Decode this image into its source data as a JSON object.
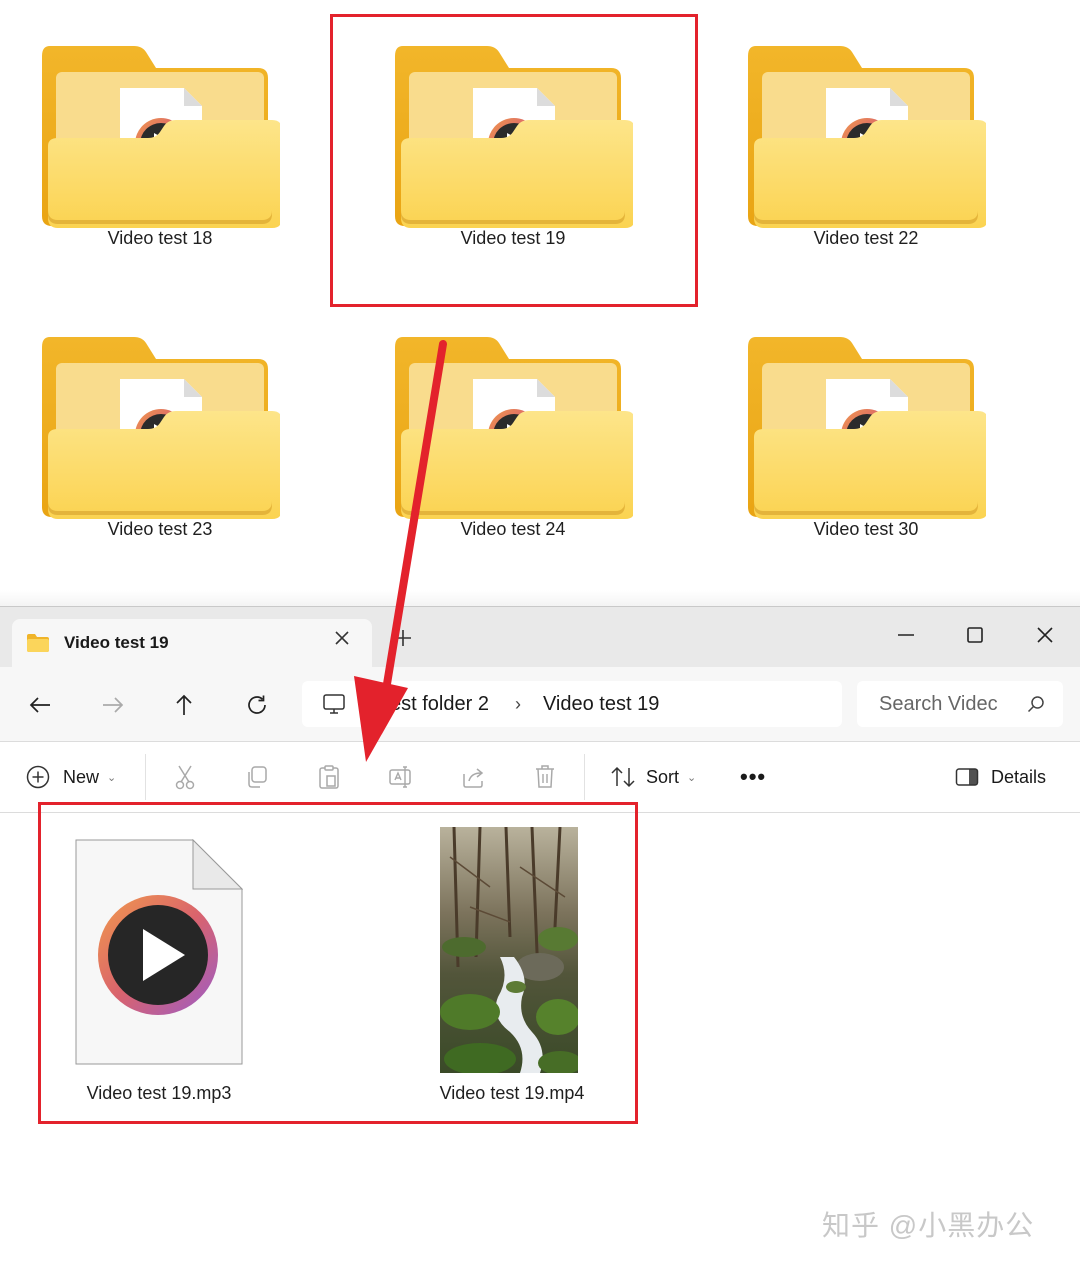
{
  "folder_grid": {
    "items": [
      {
        "label": "Video test 18"
      },
      {
        "label": "Video test 19",
        "selected": true
      },
      {
        "label": "Video test 22"
      },
      {
        "label": "Video test 23"
      },
      {
        "label": "Video test 24"
      },
      {
        "label": "Video test 30"
      }
    ],
    "icon": "folder-with-video-file-icon"
  },
  "annotation": {
    "highlight_color": "#e3222c",
    "arrow": "red-arrow-icon"
  },
  "window": {
    "tab": {
      "title": "Video test 19",
      "icon": "folder-icon",
      "close_icon": "close-icon"
    },
    "new_tab_icon": "plus-icon",
    "controls": {
      "minimize": "minimize-icon",
      "maximize": "maximize-icon",
      "close": "close-icon"
    },
    "nav": {
      "back": "back-arrow-icon",
      "forward": "forward-arrow-icon",
      "up": "up-arrow-icon",
      "refresh": "refresh-icon"
    },
    "address": {
      "icon": "this-pc-icon",
      "breadcrumbs": [
        "Test folder 2",
        "Video test 19"
      ],
      "separator": "›"
    },
    "search": {
      "placeholder": "Search Videc",
      "icon": "search-icon"
    },
    "toolbar": {
      "new_label": "New",
      "cut": "cut-icon",
      "copy": "copy-icon",
      "paste": "paste-icon",
      "rename": "rename-icon",
      "share": "share-icon",
      "delete": "delete-icon",
      "sort_label": "Sort",
      "more": "•••",
      "details_label": "Details"
    },
    "files": [
      {
        "name": "Video test 19.mp3",
        "icon": "audio-video-file-icon"
      },
      {
        "name": "Video test 19.mp4",
        "icon": "waterfall-thumbnail"
      }
    ]
  },
  "watermark": "知乎 @小黑办公"
}
